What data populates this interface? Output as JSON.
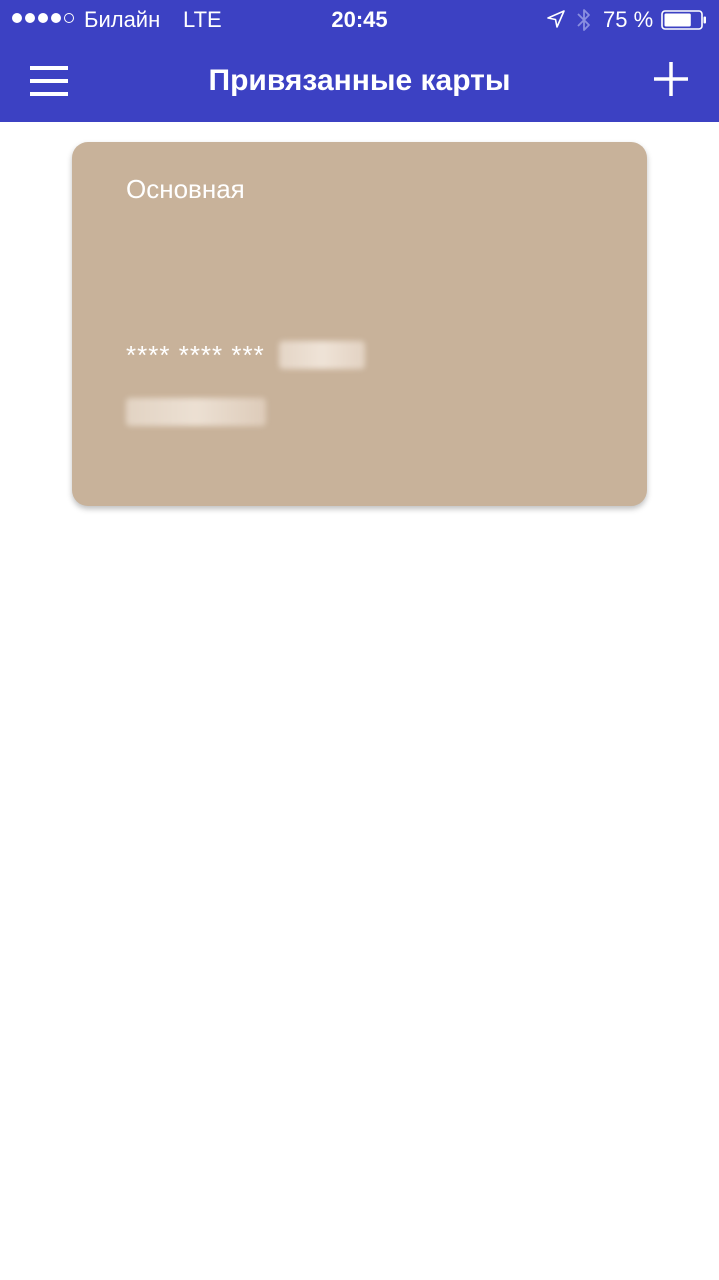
{
  "status_bar": {
    "carrier": "Билайн",
    "network": "LTE",
    "time": "20:45",
    "battery_percent": "75 %",
    "signal_strength": 4,
    "signal_max": 5,
    "battery_level": 0.75,
    "icons": [
      "location-arrow-icon",
      "bluetooth-icon",
      "battery-icon"
    ]
  },
  "header": {
    "title": "Привязанные карты",
    "menu_icon": "hamburger-menu-icon",
    "add_icon": "plus-icon",
    "background_color": "#3c41c3"
  },
  "cards": [
    {
      "name": "Основная",
      "number_masked": "**** **** ***",
      "color": "#c8b29a"
    }
  ]
}
